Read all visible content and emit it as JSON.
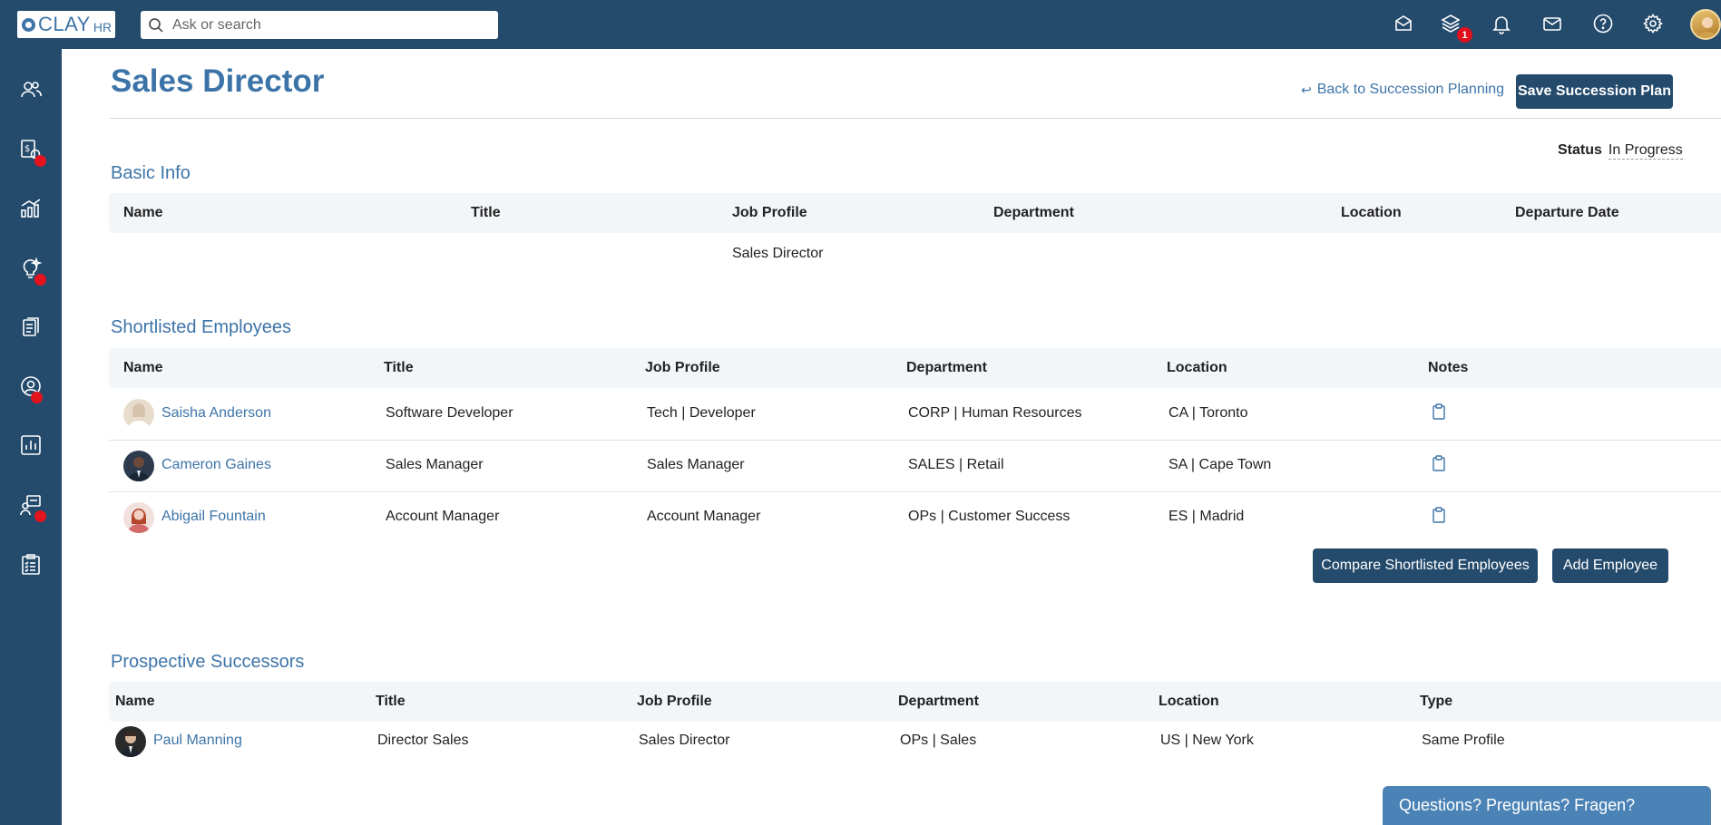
{
  "logo": {
    "text": "CLAY",
    "sub": "HR"
  },
  "search": {
    "placeholder": "Ask or search"
  },
  "topbar": {
    "icons": [
      "inbox-icon",
      "layers-icon",
      "bell-icon",
      "mail-icon",
      "help-icon",
      "settings-icon"
    ],
    "layers_badge": "1"
  },
  "sidebar": {
    "items": [
      {
        "name": "people-icon",
        "dot": false
      },
      {
        "name": "compensation-icon",
        "dot": true
      },
      {
        "name": "analytics-icon",
        "dot": false
      },
      {
        "name": "ideas-icon",
        "dot": true
      },
      {
        "name": "documents-icon",
        "dot": false
      },
      {
        "name": "profile-icon",
        "dot": true
      },
      {
        "name": "reports-icon",
        "dot": false
      },
      {
        "name": "training-icon",
        "dot": true
      },
      {
        "name": "checklist-icon",
        "dot": false
      }
    ]
  },
  "page": {
    "title": "Sales Director",
    "back_label": "Back to Succession Planning",
    "save_label": "Save Succession Plan",
    "status_label": "Status",
    "status_value": "In Progress"
  },
  "basic_info": {
    "title": "Basic Info",
    "headers": [
      "Name",
      "Title",
      "Job Profile",
      "Department",
      "Location",
      "Departure Date"
    ],
    "row": {
      "name": "",
      "title": "",
      "job_profile": "Sales Director",
      "department": "",
      "location": "",
      "departure_date": ""
    }
  },
  "shortlisted": {
    "title": "Shortlisted Employees",
    "headers": [
      "Name",
      "Title",
      "Job Profile",
      "Department",
      "Location",
      "Notes"
    ],
    "rows": [
      {
        "name": "Saisha Anderson",
        "title": "Software Developer",
        "job_profile": "Tech | Developer",
        "department": "CORP | Human Resources",
        "location": "CA | Toronto"
      },
      {
        "name": "Cameron Gaines",
        "title": "Sales Manager",
        "job_profile": "Sales Manager",
        "department": "SALES | Retail",
        "location": "SA | Cape Town"
      },
      {
        "name": "Abigail Fountain",
        "title": "Account Manager",
        "job_profile": "Account Manager",
        "department": "OPs | Customer Success",
        "location": "ES | Madrid"
      }
    ],
    "compare_label": "Compare Shortlisted Employees",
    "add_label": "Add Employee"
  },
  "prospective": {
    "title": "Prospective Successors",
    "headers": [
      "Name",
      "Title",
      "Job Profile",
      "Department",
      "Location",
      "Type"
    ],
    "rows": [
      {
        "name": "Paul Manning",
        "title": "Director Sales",
        "job_profile": "Sales Director",
        "department": "OPs | Sales",
        "location": "US | New York",
        "type": "Same Profile"
      }
    ]
  },
  "chat": {
    "label": "Questions? Preguntas? Fragen?"
  },
  "colors": {
    "nav": "#244a6c",
    "accent": "#3d74a8",
    "badge": "#e0111d"
  }
}
